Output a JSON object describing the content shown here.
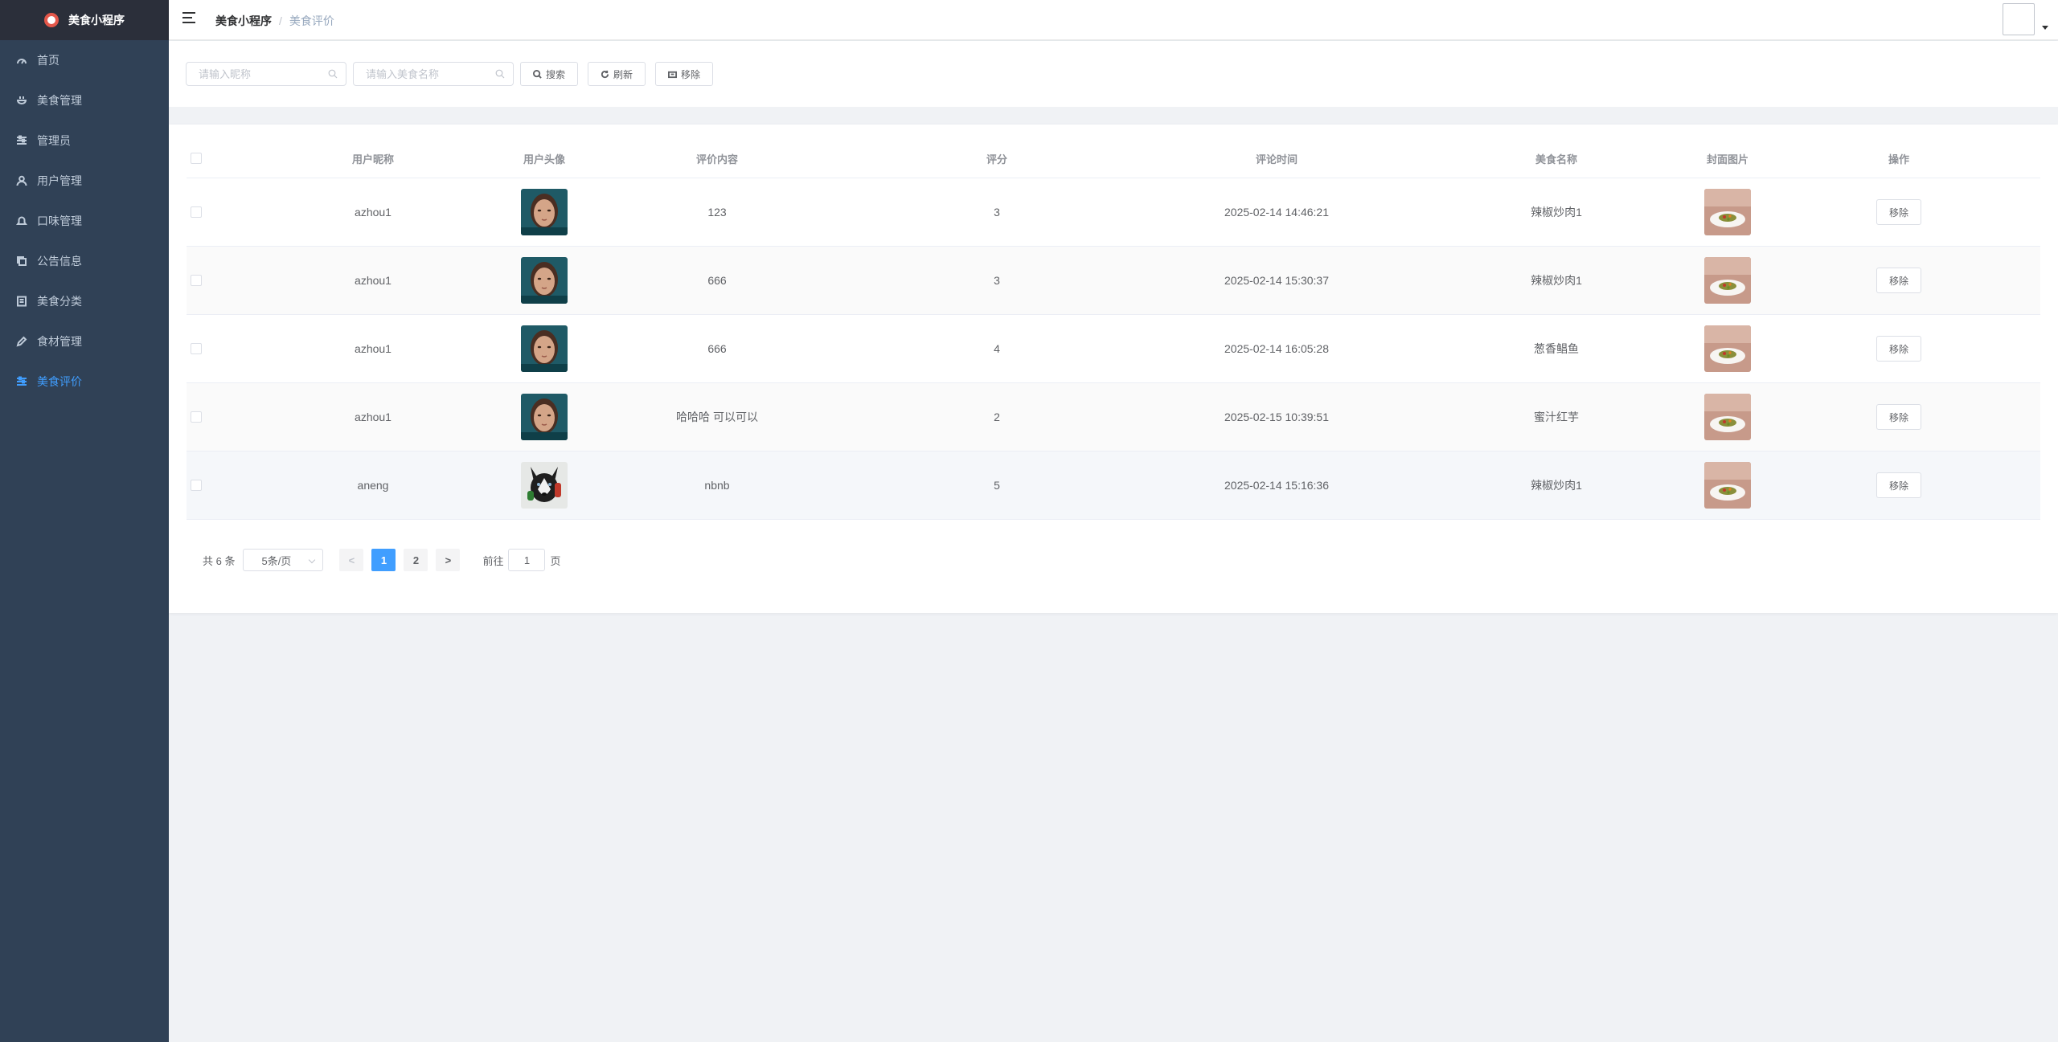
{
  "app": {
    "title": "美食小程序",
    "brand_color": "#409eff",
    "sidebar_bg": "#304156"
  },
  "sidebar": {
    "items": [
      {
        "label": "首页",
        "icon": "dashboard-icon",
        "active": false
      },
      {
        "label": "美食管理",
        "icon": "food-icon",
        "active": false
      },
      {
        "label": "管理员",
        "icon": "sliders-icon",
        "active": false
      },
      {
        "label": "用户管理",
        "icon": "user-icon",
        "active": false
      },
      {
        "label": "口味管理",
        "icon": "bell-icon",
        "active": false
      },
      {
        "label": "公告信息",
        "icon": "copy-icon",
        "active": false
      },
      {
        "label": "美食分类",
        "icon": "list-icon",
        "active": false
      },
      {
        "label": "食材管理",
        "icon": "pen-icon",
        "active": false
      },
      {
        "label": "美食评价",
        "icon": "sliders-icon",
        "active": true
      }
    ]
  },
  "navbar": {
    "breadcrumb": [
      "美食小程序",
      "美食评价"
    ],
    "separator": "/"
  },
  "filters": {
    "nickname_placeholder": "请输入昵称",
    "food_name_placeholder": "请输入美食名称",
    "search_label": "搜索",
    "refresh_label": "刷新",
    "remove_label": "移除"
  },
  "table": {
    "columns": [
      "用户昵称",
      "用户头像",
      "评价内容",
      "评分",
      "评论时间",
      "美食名称",
      "封面图片",
      "操作"
    ],
    "rows": [
      {
        "nickname": "azhou1",
        "avatar": "woman-portrait",
        "content": "123",
        "score": "3",
        "time": "2025-02-14 14:46:21",
        "food": "辣椒炒肉1",
        "cover": "food-plate",
        "action": "移除"
      },
      {
        "nickname": "azhou1",
        "avatar": "woman-portrait",
        "content": "666",
        "score": "3",
        "time": "2025-02-14 15:30:37",
        "food": "辣椒炒肉1",
        "cover": "food-plate",
        "action": "移除"
      },
      {
        "nickname": "azhou1",
        "avatar": "woman-portrait",
        "content": "666",
        "score": "4",
        "time": "2025-02-14 16:05:28",
        "food": "葱香鲳鱼",
        "cover": "food-plate",
        "action": "移除"
      },
      {
        "nickname": "azhou1",
        "avatar": "woman-portrait",
        "content": "哈哈哈 可以可以",
        "score": "2",
        "time": "2025-02-15 10:39:51",
        "food": "蜜汁红芋",
        "cover": "food-plate",
        "action": "移除"
      },
      {
        "nickname": "aneng",
        "avatar": "husky-dog",
        "content": "nbnb",
        "score": "5",
        "time": "2025-02-14 15:16:36",
        "food": "辣椒炒肉1",
        "cover": "food-plate",
        "action": "移除"
      }
    ]
  },
  "pagination": {
    "total_text": "共 6 条",
    "page_size": "5条/页",
    "prev": "<",
    "pages": [
      "1",
      "2"
    ],
    "current": "1",
    "next": ">",
    "goto_prefix": "前往",
    "goto_value": "1",
    "goto_suffix": "页"
  }
}
